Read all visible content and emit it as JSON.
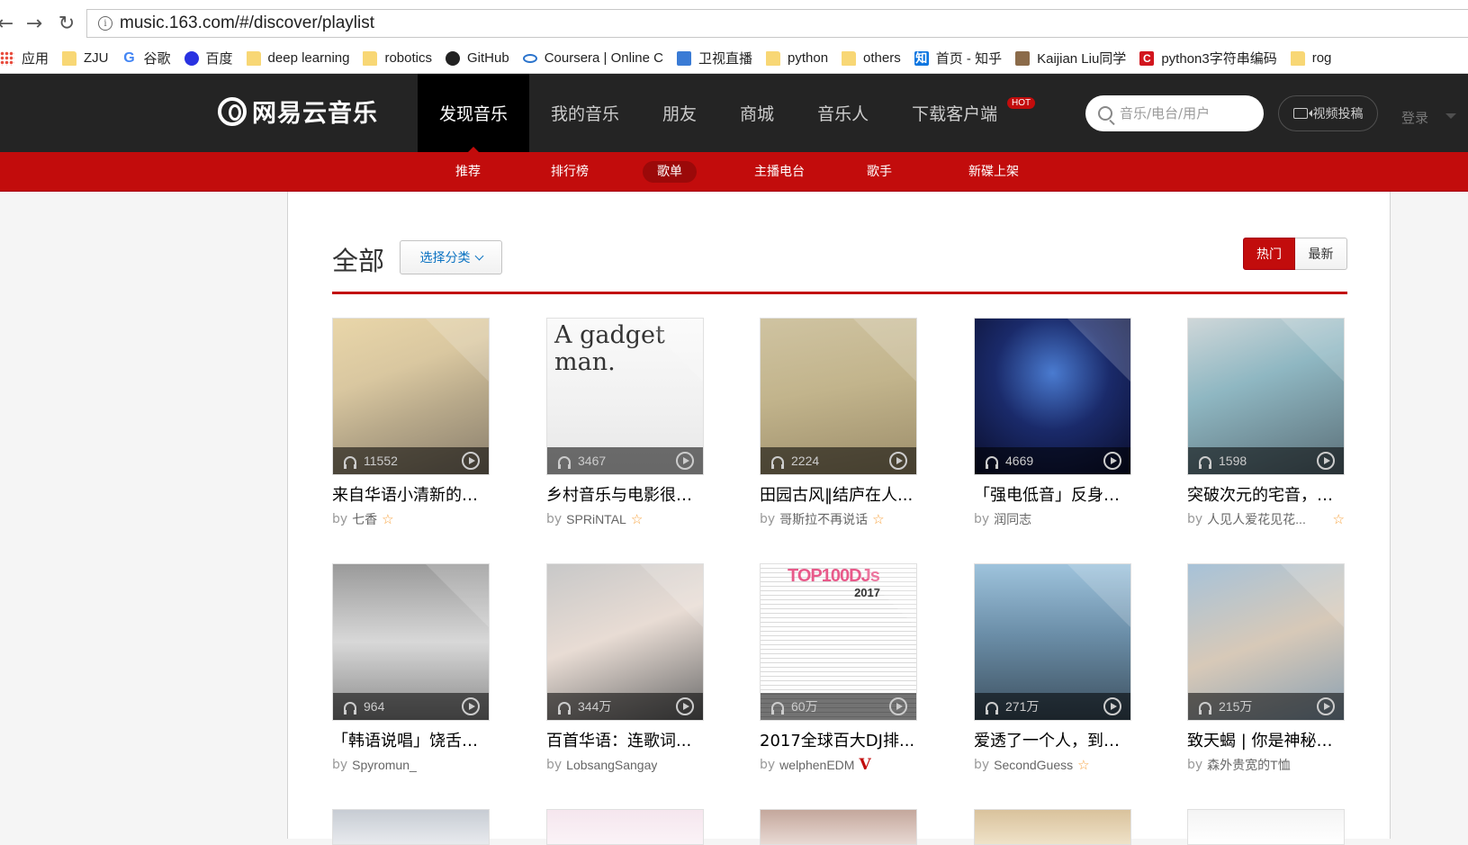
{
  "browser": {
    "url": "music.163.com/#/discover/playlist",
    "bookmarks": [
      {
        "label": "应用",
        "icon": "apps-grid-icon"
      },
      {
        "label": "ZJU",
        "icon": "folder-icon"
      },
      {
        "label": "谷歌",
        "icon": "google-icon"
      },
      {
        "label": "百度",
        "icon": "baidu-paw-icon"
      },
      {
        "label": "deep learning",
        "icon": "folder-icon"
      },
      {
        "label": "robotics",
        "icon": "folder-icon"
      },
      {
        "label": "GitHub",
        "icon": "github-icon"
      },
      {
        "label": "Coursera | Online C",
        "icon": "coursera-icon"
      },
      {
        "label": "卫视直播",
        "icon": "tv-icon"
      },
      {
        "label": "python",
        "icon": "folder-icon"
      },
      {
        "label": "others",
        "icon": "folder-icon"
      },
      {
        "label": "首页 - 知乎",
        "icon": "zhihu-icon"
      },
      {
        "label": "Kaijian Liu同学",
        "icon": "avatar-icon"
      },
      {
        "label": "python3字符串编码",
        "icon": "csdn-icon"
      },
      {
        "label": "rog",
        "icon": "folder-icon"
      }
    ]
  },
  "header": {
    "logo_text": "网易云音乐",
    "nav": [
      {
        "label": "发现音乐",
        "active": true
      },
      {
        "label": "我的音乐",
        "active": false
      },
      {
        "label": "朋友",
        "active": false
      },
      {
        "label": "商城",
        "active": false
      },
      {
        "label": "音乐人",
        "active": false
      },
      {
        "label": "下载客户端",
        "active": false,
        "badge": "HOT"
      }
    ],
    "search_placeholder": "音乐/电台/用户",
    "video_button": "视频投稿",
    "login": "登录"
  },
  "subnav": [
    {
      "label": "推荐",
      "active": false
    },
    {
      "label": "排行榜",
      "active": false
    },
    {
      "label": "歌单",
      "active": true
    },
    {
      "label": "主播电台",
      "active": false
    },
    {
      "label": "歌手",
      "active": false
    },
    {
      "label": "新碟上架",
      "active": false
    }
  ],
  "colors": {
    "brand_red": "#c20c0c",
    "dark_bar": "#242424"
  },
  "main": {
    "title": "全部",
    "category_button": "选择分类",
    "sort": {
      "hot": "热门",
      "new": "最新"
    }
  },
  "playlists": [
    {
      "plays": "11552",
      "title": "来自华语小清新的问候",
      "by": "by",
      "creator": "七香",
      "badge": "star"
    },
    {
      "plays": "3467",
      "title": "乡村音乐与电影很搭哦",
      "by": "by",
      "creator": "SPRiNTAL",
      "badge": "star",
      "cover_text": "A gadget man."
    },
    {
      "plays": "2224",
      "title": "田园古风‖结庐在人...",
      "by": "by",
      "creator": "哥斯拉不再说话",
      "badge": "star"
    },
    {
      "plays": "4669",
      "title": "「强电低音」反身体...",
      "by": "by",
      "creator": "润同志",
      "badge": ""
    },
    {
      "plays": "1598",
      "title": "突破次元的宅音，你...",
      "by": "by",
      "creator": "人见人爱花见花...",
      "badge": "star"
    },
    {
      "plays": "964",
      "title": "「韩语说唱」饶舌是...",
      "by": "by",
      "creator": "Spyromun_",
      "badge": ""
    },
    {
      "plays": "344万",
      "title": "百首华语：连歌词...",
      "by": "by",
      "creator": "LobsangSangay",
      "badge": ""
    },
    {
      "plays": "60万",
      "title": "2017全球百大DJ排...",
      "by": "by",
      "creator": "welphenEDM",
      "badge": "v",
      "cover_text": "TOP100DJs",
      "cover_year": "2017"
    },
    {
      "plays": "271万",
      "title": "爱透了一个人，到底...",
      "by": "by",
      "creator": "SecondGuess",
      "badge": "star"
    },
    {
      "plays": "215万",
      "title": "致天蝎 | 你是神秘还...",
      "by": "by",
      "creator": "森外贵宽的T恤",
      "badge": ""
    }
  ]
}
